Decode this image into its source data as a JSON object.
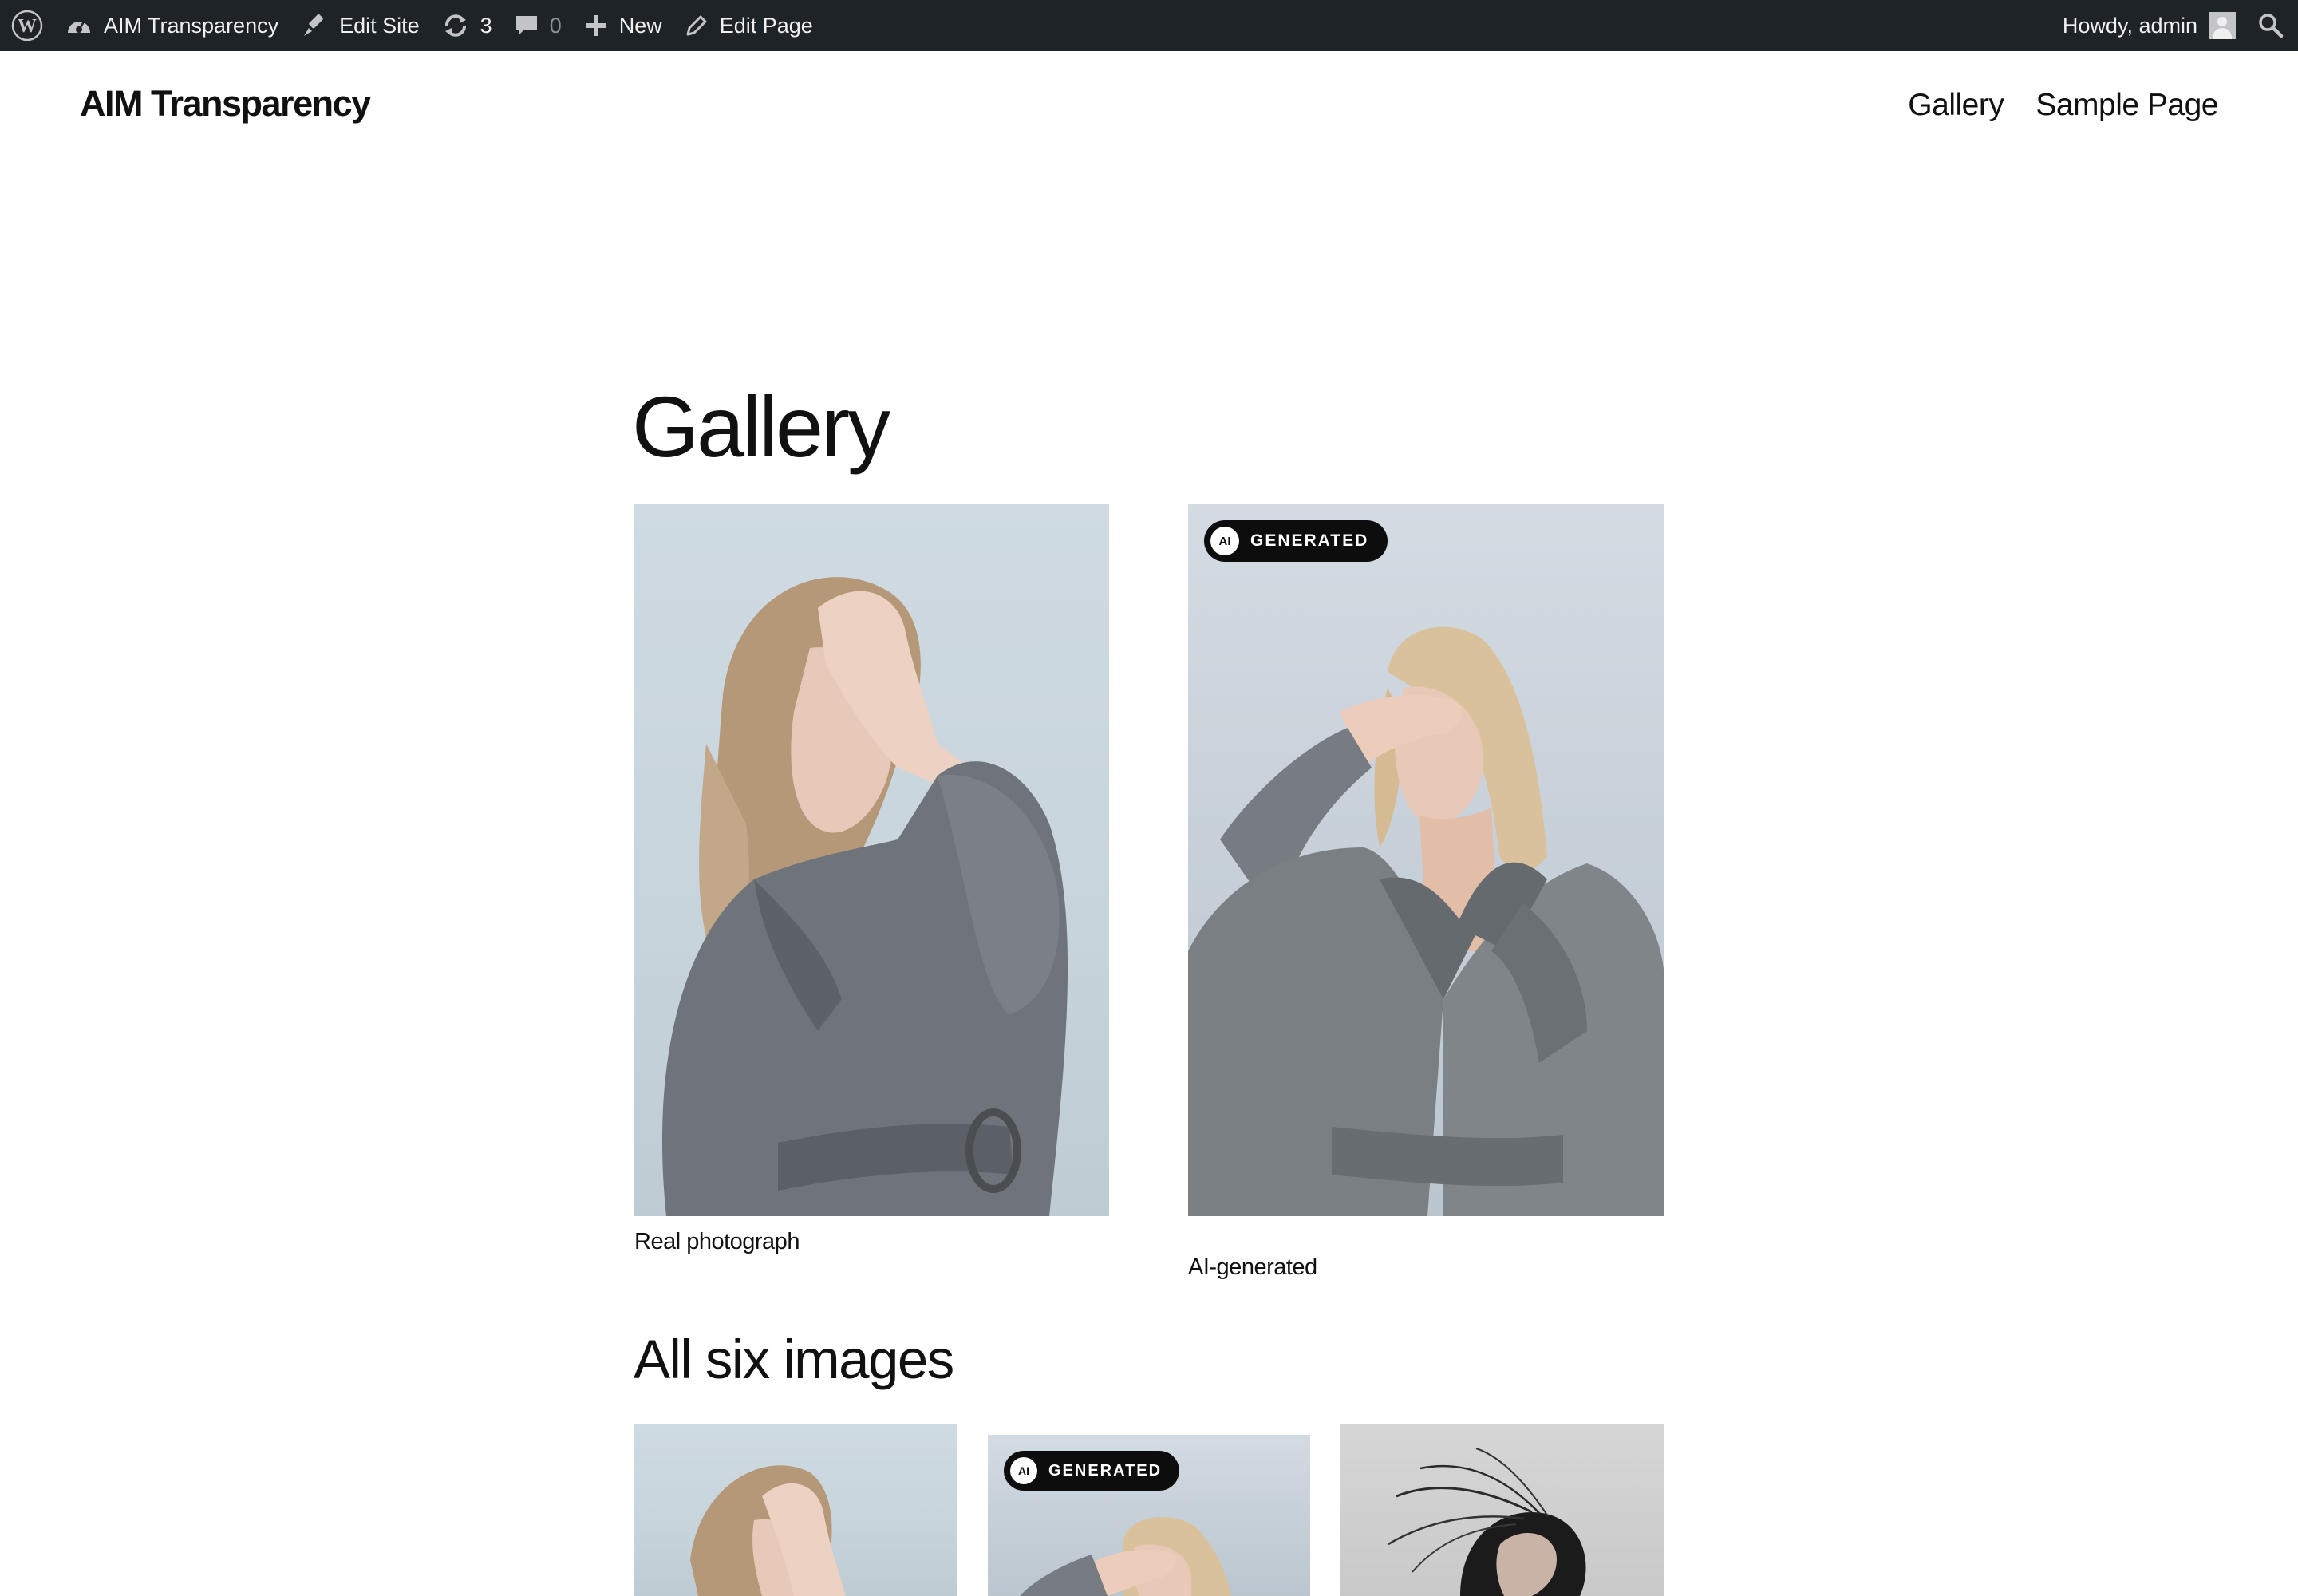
{
  "admin_bar": {
    "site_name": "AIM Transparency",
    "edit_site": "Edit Site",
    "updates_count": "3",
    "comments_count": "0",
    "new_label": "New",
    "edit_page": "Edit Page",
    "greeting": "Howdy, admin",
    "icons": {
      "wordpress": "wordpress-logo-icon",
      "dashboard": "dashboard-gauge-icon",
      "edit_site": "brush-icon",
      "updates": "refresh-icon",
      "comments": "comment-bubble-icon",
      "new": "plus-icon",
      "edit_page": "pencil-icon",
      "search": "search-icon"
    }
  },
  "site": {
    "title": "AIM Transparency",
    "nav": [
      "Gallery",
      "Sample Page"
    ]
  },
  "page": {
    "heading": "Gallery",
    "featured": [
      {
        "caption": "Real photograph",
        "badge": ""
      },
      {
        "caption": "AI-generated",
        "badge": "GENERATED",
        "badge_prefix": "AI"
      }
    ],
    "section_heading": "All six images",
    "thumbnails": [
      {
        "badge": ""
      },
      {
        "badge": "GENERATED",
        "badge_prefix": "AI"
      },
      {
        "badge": ""
      }
    ]
  },
  "colors": {
    "admin_bar_bg": "#1d2327",
    "badge_bg": "#0d0d0d",
    "text": "#111111"
  }
}
